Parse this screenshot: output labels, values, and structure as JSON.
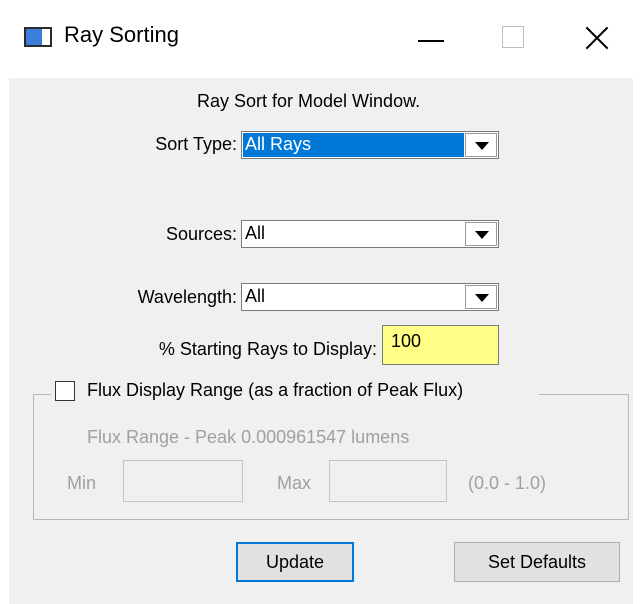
{
  "window": {
    "title": "Ray Sorting",
    "icon": "app-window-icon",
    "controls": [
      "minimize-icon",
      "maximize-icon",
      "close-icon"
    ]
  },
  "form": {
    "heading": "Ray Sort for Model Window.",
    "sort_type": {
      "label": "Sort Type:",
      "value": "All Rays"
    },
    "sources": {
      "label": "Sources:",
      "value": "All"
    },
    "wavelength": {
      "label": "Wavelength:",
      "value": "All"
    },
    "starting_rays": {
      "label": "% Starting Rays to Display:",
      "value": "100"
    }
  },
  "flux": {
    "checkbox_label": "Flux Display Range (as a fraction of Peak Flux)",
    "checked": false,
    "range_text": "Flux Range - Peak 0.000961547 lumens",
    "min_label": "Min",
    "min_value": "",
    "max_label": "Max",
    "max_value": "",
    "range_hint": "(0.0 - 1.0)"
  },
  "buttons": {
    "update": "Update",
    "set_defaults": "Set Defaults"
  },
  "colors": {
    "selection": "#0078d7",
    "highlight_input": "#ffff88",
    "dialog_bg": "#f0f0f0"
  }
}
